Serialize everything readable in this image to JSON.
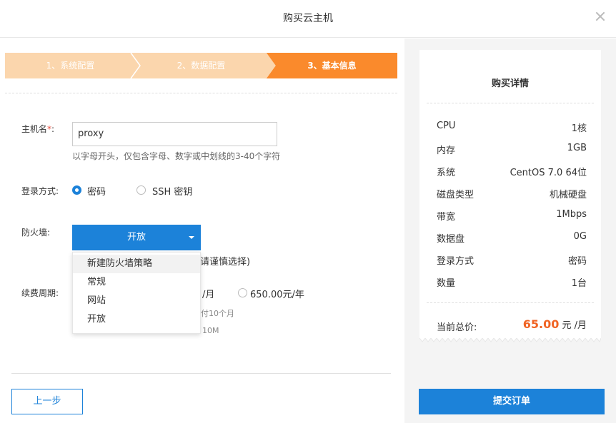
{
  "dialog": {
    "title": "购买云主机"
  },
  "steps": [
    {
      "label": "1、系统配置"
    },
    {
      "label": "2、数据配置"
    },
    {
      "label": "3、基本信息"
    }
  ],
  "form": {
    "hostname_label": "主机名",
    "required_mark": "*",
    "hostname_colon": ":",
    "hostname_value": "proxy",
    "hostname_hint": "以字母开头，仅包含字母、数字或中划线的3-40个字符",
    "login_label": "登录方式:",
    "login_options": [
      "密码",
      "SSH 密钥"
    ],
    "login_selected": "密码",
    "firewall_label": "防火墙:",
    "firewall_selected": "开放",
    "firewall_options": [
      "新建防火墙策略",
      "常规",
      "网站",
      "开放"
    ],
    "firewall_note_partial": "请谨慎选择)",
    "billing_label": "续费周期:",
    "billing_partial_monthly": "/月",
    "billing_yearly": "650.00元/年",
    "billing_note1_partial": "付10个月",
    "billing_note2_partial": "10M"
  },
  "buttons": {
    "prev": "上一步",
    "submit": "提交订单"
  },
  "summary": {
    "title": "购买详情",
    "rows": [
      {
        "k": "CPU",
        "v": "1核"
      },
      {
        "k": "内存",
        "v": "1GB"
      },
      {
        "k": "系统",
        "v": "CentOS 7.0 64位"
      },
      {
        "k": "磁盘类型",
        "v": "机械硬盘"
      },
      {
        "k": "带宽",
        "v": "1Mbps"
      },
      {
        "k": "数据盘",
        "v": "0G"
      },
      {
        "k": "登录方式",
        "v": "密码"
      },
      {
        "k": "数量",
        "v": "1台"
      }
    ],
    "total_label": "当前总价:",
    "total_amount": "65.00",
    "total_unit": " 元 /月"
  },
  "colors": {
    "primary": "#1c82d9",
    "step_active": "#fa8a2c",
    "step_inactive": "#fbd6ad",
    "price": "#f06424"
  }
}
